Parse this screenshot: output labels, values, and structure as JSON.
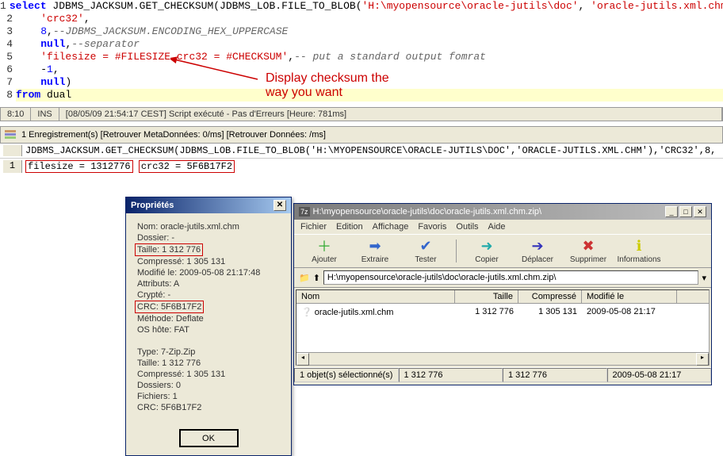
{
  "code": {
    "lines": [
      {
        "n": "1",
        "parts": [
          {
            "t": "select",
            "c": "kw"
          },
          {
            "t": " JDBMS_JACKSUM.GET_CHECKSUM(JDBMS_LOB.FILE_TO_BLOB(",
            "c": "normal"
          },
          {
            "t": "'H:\\myopensource\\oracle-jutils\\doc'",
            "c": "str"
          },
          {
            "t": ", ",
            "c": "normal"
          },
          {
            "t": "'oracle-jutils.xml.chm'",
            "c": "str"
          },
          {
            "t": "),",
            "c": "normal"
          }
        ]
      },
      {
        "n": "2",
        "parts": [
          {
            "t": "    ",
            "c": "normal"
          },
          {
            "t": "'crc32'",
            "c": "str"
          },
          {
            "t": ",",
            "c": "normal"
          }
        ]
      },
      {
        "n": "3",
        "parts": [
          {
            "t": "    ",
            "c": "normal"
          },
          {
            "t": "8",
            "c": "num"
          },
          {
            "t": ",",
            "c": "normal"
          },
          {
            "t": "--JDBMS_JACKSUM.ENCODING_HEX_UPPERCASE",
            "c": "comment"
          }
        ]
      },
      {
        "n": "4",
        "parts": [
          {
            "t": "    ",
            "c": "normal"
          },
          {
            "t": "null",
            "c": "kw"
          },
          {
            "t": ",",
            "c": "normal"
          },
          {
            "t": "--separator",
            "c": "comment"
          }
        ]
      },
      {
        "n": "5",
        "parts": [
          {
            "t": "    ",
            "c": "normal"
          },
          {
            "t": "'filesize = #FILESIZE crc32 = #CHECKSUM'",
            "c": "str"
          },
          {
            "t": ",",
            "c": "normal"
          },
          {
            "t": "-- put a standard output fomrat",
            "c": "comment"
          }
        ]
      },
      {
        "n": "6",
        "parts": [
          {
            "t": "    -",
            "c": "normal"
          },
          {
            "t": "1",
            "c": "num"
          },
          {
            "t": ",",
            "c": "normal"
          }
        ]
      },
      {
        "n": "7",
        "parts": [
          {
            "t": "    ",
            "c": "normal"
          },
          {
            "t": "null",
            "c": "kw"
          },
          {
            "t": ")",
            "c": "normal"
          }
        ]
      },
      {
        "n": "8",
        "parts": [
          {
            "t": "from",
            "c": "kw"
          },
          {
            "t": " dual",
            "c": "normal"
          }
        ],
        "hl": true
      }
    ]
  },
  "annotation": {
    "l1": "Display checksum the",
    "l2": "way you want"
  },
  "status": {
    "pos": "8:10",
    "mode": "INS",
    "msg": "[08/05/09 21:54:17 CEST] Script exécuté - Pas d'Erreurs [Heure: 781ms]"
  },
  "resultsbar": "1 Enregistrement(s) [Retrouver MetaDonnées: 0/ms] [Retrouver Données: /ms]",
  "result_header": "JDBMS_JACKSUM.GET_CHECKSUM(JDBMS_LOB.FILE_TO_BLOB('H:\\MYOPENSOURCE\\ORACLE-JUTILS\\DOC','ORACLE-JUTILS.XML.CHM'),'CRC32',8,",
  "result_row": {
    "num": "1",
    "part1": "filesize = 1312776",
    "part2": "crc32 = 5F6B17F2"
  },
  "properties": {
    "title": "Propriétés",
    "lines1": [
      "Nom: oracle-jutils.xml.chm",
      "Dossier: -"
    ],
    "hl1": "Taille: 1 312 776",
    "lines2": [
      "Compressé: 1 305 131",
      "Modifié le: 2009-05-08 21:17:48",
      "Attributs: A",
      "Crypté: -"
    ],
    "hl2": "CRC: 5F6B17F2",
    "lines3": [
      "Méthode: Deflate",
      "OS hôte: FAT"
    ],
    "lines4": [
      "Type: 7-Zip.Zip",
      "Taille: 1 312 776",
      "Compressé: 1 305 131",
      "Dossiers: 0",
      "Fichiers: 1",
      "CRC: 5F6B17F2"
    ],
    "ok": "OK"
  },
  "fm": {
    "title": "H:\\myopensource\\oracle-jutils\\doc\\oracle-jutils.xml.chm.zip\\",
    "menu": [
      "Fichier",
      "Edition",
      "Affichage",
      "Favoris",
      "Outils",
      "Aide"
    ],
    "toolbar": [
      {
        "icon": "＋",
        "label": "Ajouter",
        "color": "#3a3"
      },
      {
        "icon": "➡",
        "label": "Extraire",
        "color": "#36c"
      },
      {
        "icon": "✔",
        "label": "Tester",
        "color": "#36c"
      },
      {
        "sep": true
      },
      {
        "icon": "➜",
        "label": "Copier",
        "color": "#2aa"
      },
      {
        "icon": "➔",
        "label": "Déplacer",
        "color": "#33b"
      },
      {
        "icon": "✖",
        "label": "Supprimer",
        "color": "#c33"
      },
      {
        "icon": "ℹ",
        "label": "Informations",
        "color": "#cc0"
      }
    ],
    "address": "H:\\myopensource\\oracle-jutils\\doc\\oracle-jutils.xml.chm.zip\\",
    "cols": {
      "name": "Nom",
      "size": "Taille",
      "comp": "Compressé",
      "date": "Modifié le"
    },
    "rows": [
      {
        "name": "oracle-jutils.xml.chm",
        "size": "1 312 776",
        "comp": "1 305 131",
        "date": "2009-05-08 21:17"
      }
    ],
    "status": {
      "sel": "1 objet(s) sélectionné(s)",
      "s1": "1 312 776",
      "s2": "1 312 776",
      "s3": "2009-05-08 21:17"
    }
  }
}
